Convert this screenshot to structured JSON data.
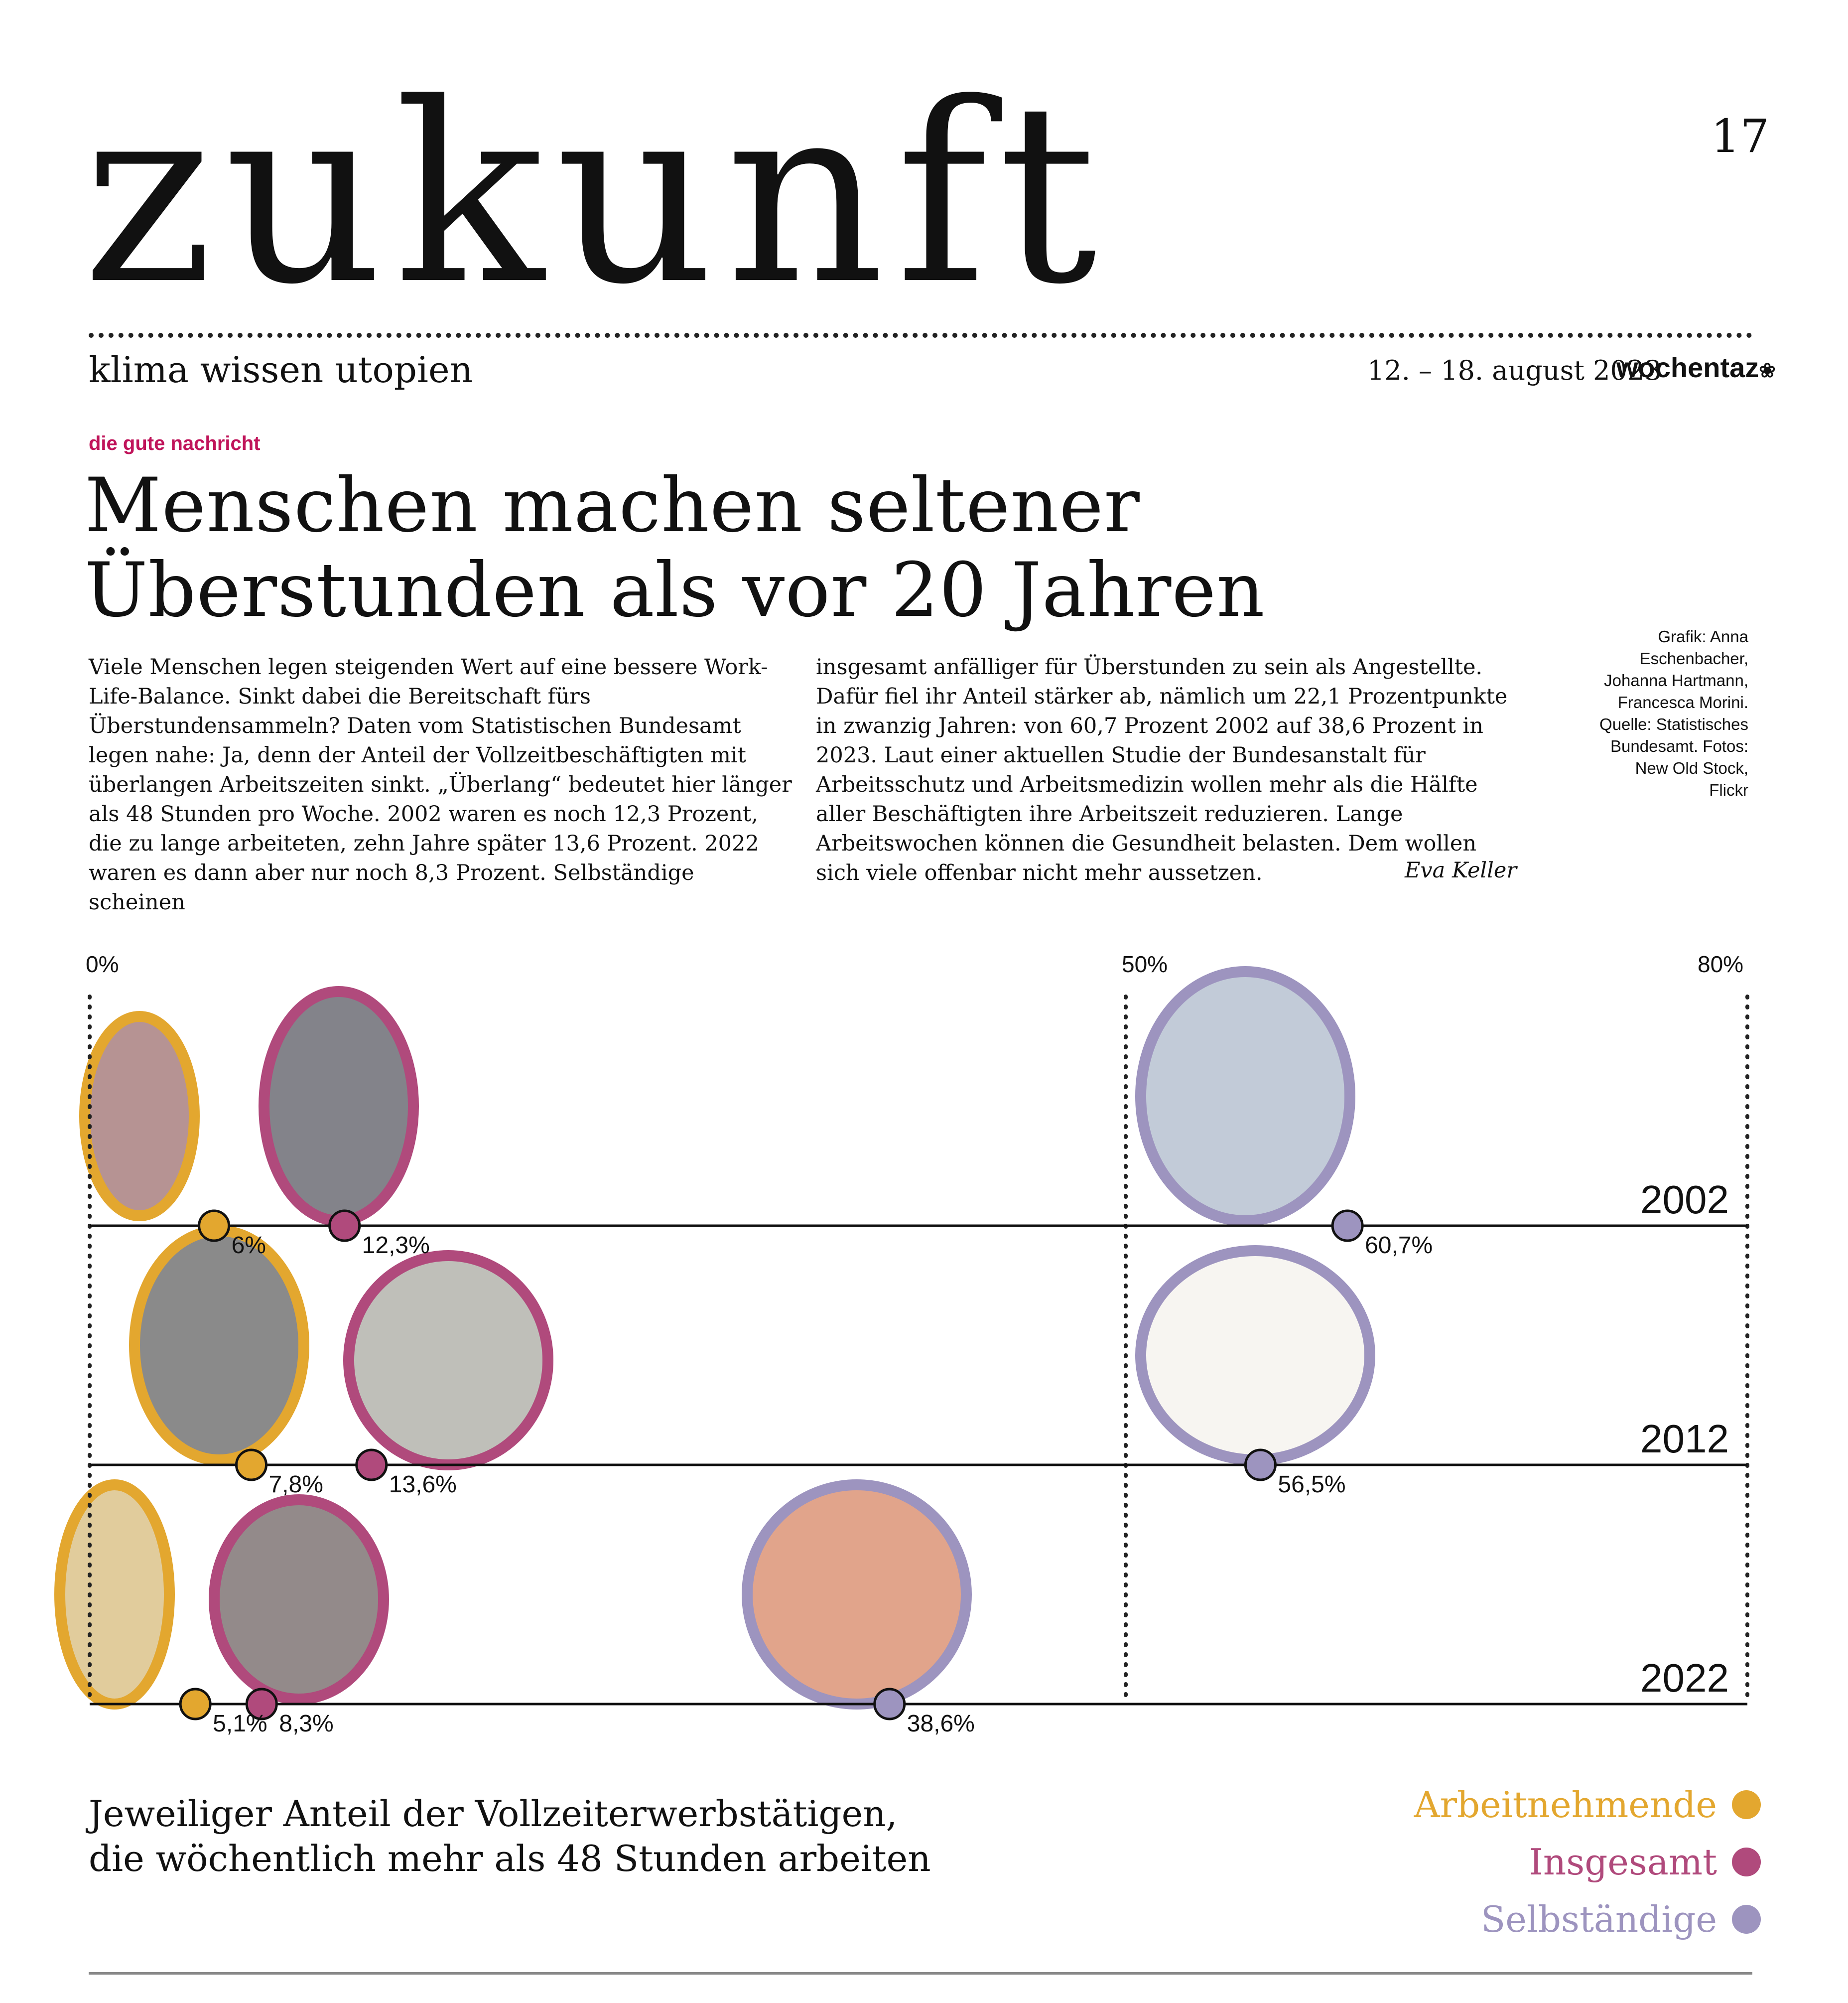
{
  "header": {
    "section_title": "zukunft",
    "page_number": "17",
    "section_subtitle": "klima wissen utopien",
    "issue_date": "12. – 18. august 2023",
    "brand": "wochentaz"
  },
  "article": {
    "kicker": "die gute nachricht",
    "headline_line1": "Menschen machen seltener",
    "headline_line2": "Überstunden als vor 20 Jahren",
    "column1": "Viele Menschen legen steigenden Wert auf eine bessere Work-Life-Balance. Sinkt dabei die Bereitschaft fürs Überstundensammeln? Daten vom Statistischen Bundesamt legen nahe: Ja, denn der Anteil der Vollzeitbeschäftigten mit überlangen Arbeitszeiten sinkt. „Überlang“ bedeutet hier länger als 48 Stunden pro Woche. 2002 waren es noch 12,3 Prozent, die zu lange arbeiteten, zehn Jahre später 13,6 Prozent. 2022 waren es dann aber nur noch 8,3 Prozent. Selbständige scheinen",
    "column2": "insgesamt anfälliger für Überstunden zu sein als Angestellte. Dafür fiel ihr Anteil stärker ab, nämlich um 22,1 Prozentpunkte in zwanzig Jahren: von 60,7 Prozent 2002 auf 38,6 Prozent in 2023. Laut einer aktuellen Studie der Bundesanstalt für Arbeitsschutz und Arbeitsmedizin wollen mehr als die Hälfte aller Beschäftigten ihre Arbeitszeit reduzieren. Lange Arbeitswochen können die Gesundheit belasten. Dem wollen sich viele offenbar nicht mehr aussetzen.",
    "author": "Eva Keller",
    "credits": "Grafik: Anna Eschenbacher, Johanna Hartmann, Francesca Morini. Quelle: Statistisches Bundesamt. Fotos: New Old Stock, Flickr"
  },
  "chart_data": {
    "type": "scatter",
    "title": "Jeweiliger Anteil der Vollzeiterwerbstätigen, die wöchentlich mehr als 48 Stunden arbeiten",
    "caption_line1": "Jeweiliger Anteil der Vollzeiterwerbstätigen,",
    "caption_line2": "die wöchentlich mehr als 48 Stunden arbeiten",
    "xlim": [
      0,
      80
    ],
    "x_ticks": [
      {
        "value": 0,
        "label": "0%"
      },
      {
        "value": 50,
        "label": "50%"
      },
      {
        "value": 80,
        "label": "80%"
      }
    ],
    "categories": [
      "2002",
      "2012",
      "2022"
    ],
    "series": [
      {
        "name": "Arbeitnehmende",
        "color": "#e3a72f",
        "values": [
          6,
          7.8,
          5.1
        ],
        "labels": [
          "6%",
          "7,8%",
          "5,1%"
        ]
      },
      {
        "name": "Insgesamt",
        "color": "#b04a7c",
        "values": [
          12.3,
          13.6,
          8.3
        ],
        "labels": [
          "12,3%",
          "13,6%",
          "8,3%"
        ]
      },
      {
        "name": "Selbständige",
        "color": "#9d94bf",
        "values": [
          60.7,
          56.5,
          38.6
        ],
        "labels": [
          "60,7%",
          "56,5%",
          "38,6%"
        ]
      }
    ],
    "legend_position": "bottom-right",
    "grid": "dotted verticals at 0%, 50%, 80%"
  }
}
